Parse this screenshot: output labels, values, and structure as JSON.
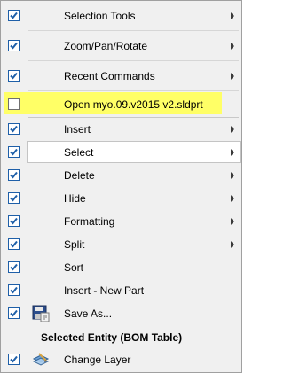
{
  "menu": {
    "items": [
      {
        "label": "Selection Tools",
        "checked": true,
        "submenu": true
      },
      {
        "label": "Zoom/Pan/Rotate",
        "checked": true,
        "submenu": true
      },
      {
        "label": "Recent Commands",
        "checked": true,
        "submenu": true
      },
      {
        "label": "Open myo.09.v2015 v2.sldprt",
        "checked": false,
        "submenu": false,
        "highlighted": true
      },
      {
        "label": "Insert",
        "checked": true,
        "submenu": true
      },
      {
        "label": "Select",
        "checked": true,
        "submenu": true,
        "selected": true
      },
      {
        "label": "Delete",
        "checked": true,
        "submenu": true
      },
      {
        "label": "Hide",
        "checked": true,
        "submenu": true
      },
      {
        "label": "Formatting",
        "checked": true,
        "submenu": true
      },
      {
        "label": "Split",
        "checked": true,
        "submenu": true
      },
      {
        "label": "Sort",
        "checked": true,
        "submenu": false
      },
      {
        "label": "Insert - New Part",
        "checked": true,
        "submenu": false
      },
      {
        "label": "Save As...",
        "checked": true,
        "submenu": false,
        "icon": "save-as-icon"
      },
      {
        "label": "Change Layer",
        "checked": true,
        "submenu": false,
        "icon": "change-layer-icon"
      }
    ],
    "section_header": "Selected Entity (BOM Table)",
    "highlight_color": "#ffff66",
    "checkbox_color": "#1e5fa8"
  }
}
